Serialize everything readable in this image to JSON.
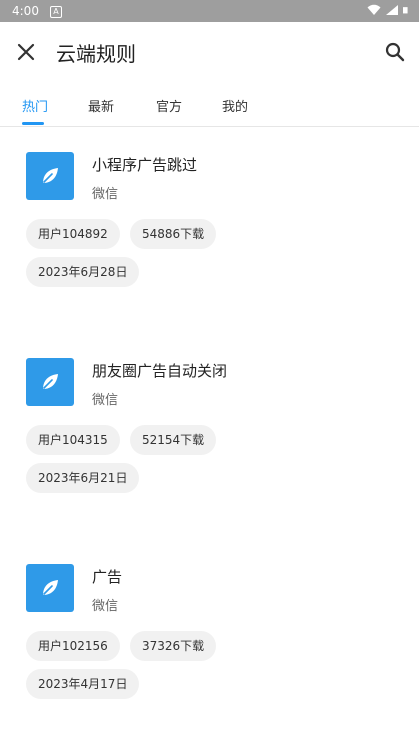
{
  "status_bar": {
    "time": "4:00",
    "notif_label": "A"
  },
  "header": {
    "title": "云端规则",
    "close_icon": "close-icon",
    "search_icon": "search-icon"
  },
  "tabs": [
    {
      "label": "热门",
      "active": true
    },
    {
      "label": "最新",
      "active": false
    },
    {
      "label": "官方",
      "active": false
    },
    {
      "label": "我的",
      "active": false
    }
  ],
  "colors": {
    "accent": "#2196f3",
    "icon_bg": "#2f9ae8",
    "chip_bg": "#f1f1f1",
    "status_bar": "#9e9e9e"
  },
  "rules": [
    {
      "title": "小程序广告跳过",
      "app": "微信",
      "user": "用户104892",
      "downloads": "54886下载",
      "date": "2023年6月28日",
      "icon": "leaf-icon"
    },
    {
      "title": "朋友圈广告自动关闭",
      "app": "微信",
      "user": "用户104315",
      "downloads": "52154下载",
      "date": "2023年6月21日",
      "icon": "leaf-icon"
    },
    {
      "title": "广告",
      "app": "微信",
      "user": "用户102156",
      "downloads": "37326下载",
      "date": "2023年4月17日",
      "icon": "leaf-icon"
    }
  ]
}
